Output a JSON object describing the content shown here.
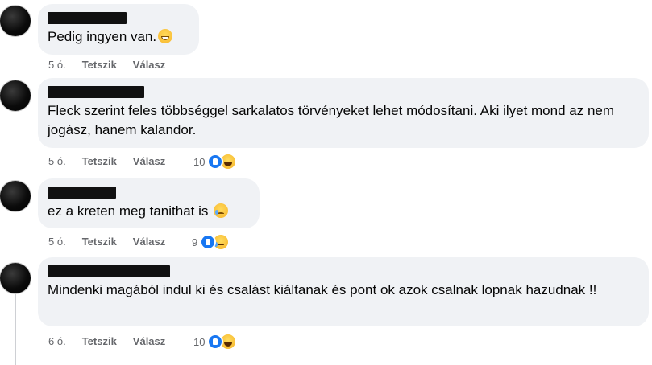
{
  "comments": [
    {
      "text": "Pedig ingyen van.",
      "emoji": "grinning-face-icon",
      "time": "5 ó.",
      "like_label": "Tetszik",
      "reply_label": "Válasz",
      "reaction_count": null
    },
    {
      "text": "Fleck szerint feles többséggel sarkalatos törvényeket lehet módosítani. Aki ilyet mond az nem jogász, hanem kalandor.",
      "time": "5 ó.",
      "like_label": "Tetszik",
      "reply_label": "Válasz",
      "reaction_count": "10",
      "reactions": [
        "like-reaction-icon",
        "haha-reaction-icon"
      ]
    },
    {
      "text": "ez a kreten meg tanithat is",
      "emoji": "crying-face-icon",
      "time": "5 ó.",
      "like_label": "Tetszik",
      "reply_label": "Válasz",
      "reaction_count": "9",
      "reactions": [
        "like-reaction-icon",
        "sad-reaction-icon"
      ]
    },
    {
      "text": "Mindenki magából indul ki és csalást kiáltanak és pont ok azok csalnak lopnak hazudnak !!",
      "time": "6 ó.",
      "like_label": "Tetszik",
      "reply_label": "Válasz",
      "reaction_count": "10",
      "reactions": [
        "like-reaction-icon",
        "haha-reaction-icon"
      ]
    }
  ],
  "colors": {
    "bubble": "#f0f2f5",
    "meta_text": "#65676b",
    "like_blue": "#1877f2"
  }
}
